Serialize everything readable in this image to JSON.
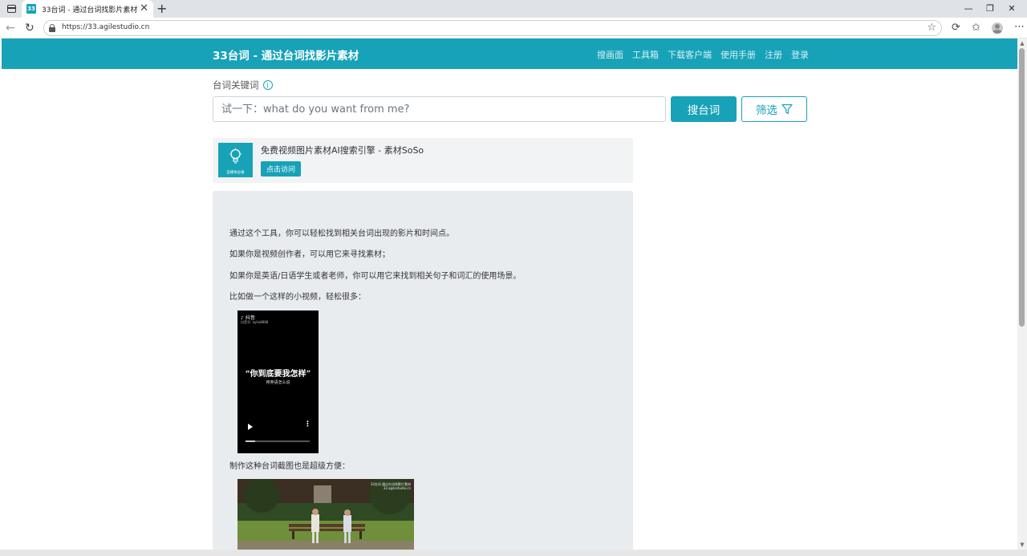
{
  "browser": {
    "tab_title": "33台词 - 通过台词找影片素材",
    "favicon_text": "33",
    "url": "https://33.agilestudio.cn",
    "new_tab_label": "+",
    "close_label": "✕",
    "minimize_label": "—",
    "maximize_label": "❐",
    "window_close_label": "✕"
  },
  "site": {
    "brand": "33台词 - 通过台词找影片素材",
    "nav": [
      "搜画面",
      "工具箱",
      "下载客户端",
      "使用手册",
      "注册",
      "登录"
    ]
  },
  "search": {
    "label": "台词关键词",
    "info_glyph": "i",
    "placeholder": "试一下：what do you want from me?",
    "value": "",
    "search_button": "搜台词",
    "filter_button": "筛选"
  },
  "ad": {
    "logo_text": "自媒体必备",
    "title": "免费视频图片素材AI搜索引擎 - 素材SoSo",
    "button": "点击访问"
  },
  "intro": {
    "paragraphs": [
      "通过这个工具，你可以轻松找到相关台词出现的影片和时间点。",
      "如果你是视频创作者，可以用它来寻找素材；",
      "如果你是英语/日语学生或者老师，你可以用它来找到相关句子和词汇的使用场景。",
      "比如做一个这样的小视频，轻松很多："
    ],
    "caption_after_video": "制作这种台词截图也是超级方便："
  },
  "video": {
    "app_name": "抖音",
    "account_id": "抖音号: ayilo8888",
    "quote": "“你到底要我怎样”",
    "subtitle": "用英语怎么说",
    "progress": 0.15
  },
  "still": {
    "watermark_line1": "33台词 通过台词找影片素材",
    "watermark_line2": "33.agilestudio.cn"
  },
  "colors": {
    "brand": "#17a2b8",
    "intro_bg": "#e9ecef",
    "ad_bg": "#f2f3f5"
  }
}
